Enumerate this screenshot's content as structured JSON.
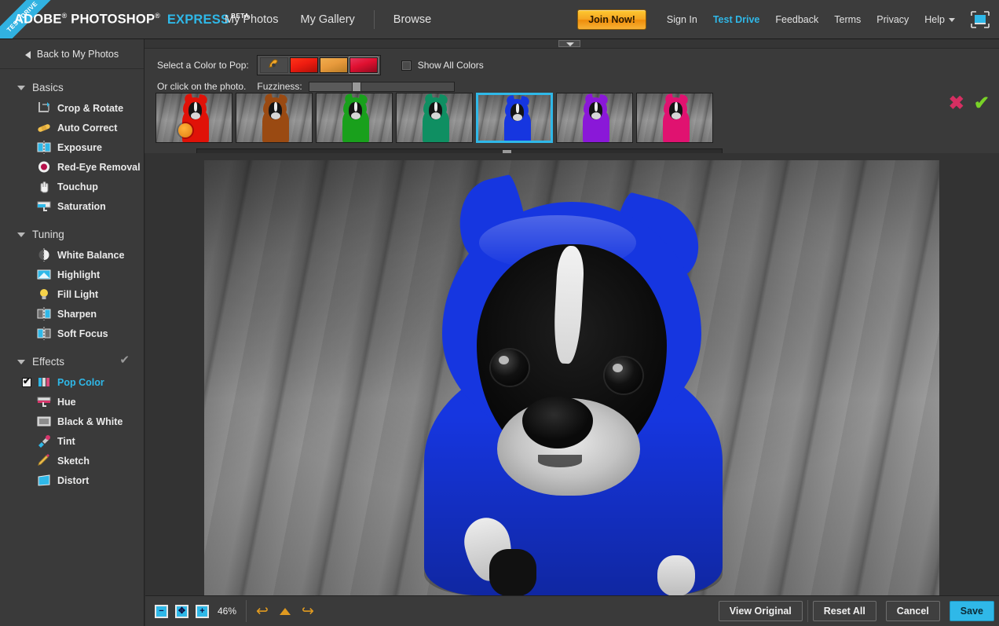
{
  "header": {
    "ribbon": "TEST DRIVE",
    "logo": {
      "adobe": "ADOBE",
      "photoshop": "PHOTOSHOP",
      "express": "EXPRESS",
      "beta": "BETA"
    },
    "nav": [
      {
        "label": "My Photos",
        "name": "nav-my-photos"
      },
      {
        "label": "My Gallery",
        "name": "nav-my-gallery"
      },
      {
        "label": "Browse",
        "name": "nav-browse"
      }
    ],
    "join_label": "Join Now!",
    "right_nav": [
      {
        "label": "Sign In",
        "active": false
      },
      {
        "label": "Test Drive",
        "active": true
      },
      {
        "label": "Feedback",
        "active": false
      },
      {
        "label": "Terms",
        "active": false
      },
      {
        "label": "Privacy",
        "active": false
      },
      {
        "label": "Help",
        "active": false
      }
    ],
    "fullscreen_icon": "fullscreen-icon",
    "accent_color": "#2fb8e8",
    "join_color": "#f5a623"
  },
  "sidebar": {
    "back_label": "Back to My Photos",
    "groups": [
      {
        "title": "Basics",
        "checked": false,
        "items": [
          {
            "label": "Crop & Rotate",
            "icon": "crop-rotate-icon",
            "active": false
          },
          {
            "label": "Auto Correct",
            "icon": "auto-correct-icon",
            "active": false
          },
          {
            "label": "Exposure",
            "icon": "exposure-icon",
            "active": false
          },
          {
            "label": "Red-Eye Removal",
            "icon": "red-eye-icon",
            "active": false
          },
          {
            "label": "Touchup",
            "icon": "touchup-icon",
            "active": false
          },
          {
            "label": "Saturation",
            "icon": "saturation-icon",
            "active": false
          }
        ]
      },
      {
        "title": "Tuning",
        "checked": false,
        "items": [
          {
            "label": "White Balance",
            "icon": "white-balance-icon",
            "active": false
          },
          {
            "label": "Highlight",
            "icon": "highlight-icon",
            "active": false
          },
          {
            "label": "Fill Light",
            "icon": "fill-light-icon",
            "active": false
          },
          {
            "label": "Sharpen",
            "icon": "sharpen-icon",
            "active": false
          },
          {
            "label": "Soft Focus",
            "icon": "soft-focus-icon",
            "active": false
          }
        ]
      },
      {
        "title": "Effects",
        "checked": true,
        "items": [
          {
            "label": "Pop Color",
            "icon": "pop-color-icon",
            "active": true,
            "checkbox": true
          },
          {
            "label": "Hue",
            "icon": "hue-icon",
            "active": false
          },
          {
            "label": "Black & White",
            "icon": "black-white-icon",
            "active": false
          },
          {
            "label": "Tint",
            "icon": "tint-icon",
            "active": false
          },
          {
            "label": "Sketch",
            "icon": "sketch-icon",
            "active": false
          },
          {
            "label": "Distort",
            "icon": "distort-icon",
            "active": false
          }
        ]
      }
    ]
  },
  "toolpanel": {
    "select_label": "Select a Color to Pop:",
    "or_click_label": "Or click on the photo.",
    "show_all_label": "Show All Colors",
    "show_all_checked": false,
    "fuzziness_label": "Fuzziness:",
    "fuzziness_percent": 33,
    "eyedropper_icon": "eyedropper-icon",
    "swatches": [
      {
        "name": "swatch-red",
        "color": "#ee1c10",
        "color2": "#b01008",
        "selected": false
      },
      {
        "name": "swatch-orange",
        "color": "#e89a3c",
        "color2": "#c27a1e",
        "selected": false
      },
      {
        "name": "swatch-crimson",
        "color": "#e01030",
        "color2": "#9a0c20",
        "selected": true
      }
    ],
    "thumbnails": [
      {
        "name": "thumb-red",
        "color": "#e01208",
        "selected": false
      },
      {
        "name": "thumb-brown",
        "color": "#9a4a12",
        "selected": false
      },
      {
        "name": "thumb-green",
        "color": "#19a01c",
        "selected": false
      },
      {
        "name": "thumb-teal",
        "color": "#0f8f62",
        "selected": false
      },
      {
        "name": "thumb-blue",
        "color": "#1636e0",
        "selected": true
      },
      {
        "name": "thumb-purple",
        "color": "#8a18d8",
        "selected": false
      },
      {
        "name": "thumb-magenta",
        "color": "#e01270",
        "selected": false
      }
    ],
    "scroll_position_percent": 59,
    "cancel_icon": "x-mark-icon",
    "apply_icon": "check-mark-icon",
    "collapse_icon": "chevron-down-icon"
  },
  "canvas": {
    "pop_color": "#1636e0",
    "subject": "boston-terrier-in-blue-hoodie"
  },
  "bottombar": {
    "zoom_out_icon": "zoom-out-icon",
    "fit_icon": "fit-to-screen-icon",
    "zoom_in_icon": "zoom-in-icon",
    "zoom_level": "46%",
    "undo_icon": "undo-icon",
    "revert_icon": "revert-icon",
    "redo_icon": "redo-icon",
    "buttons": [
      {
        "label": "View Original",
        "primary": false,
        "name": "view-original-button"
      },
      {
        "label": "Reset All",
        "primary": false,
        "name": "reset-all-button"
      },
      {
        "label": "Cancel",
        "primary": false,
        "name": "cancel-button"
      },
      {
        "label": "Save",
        "primary": true,
        "name": "save-button"
      }
    ]
  }
}
